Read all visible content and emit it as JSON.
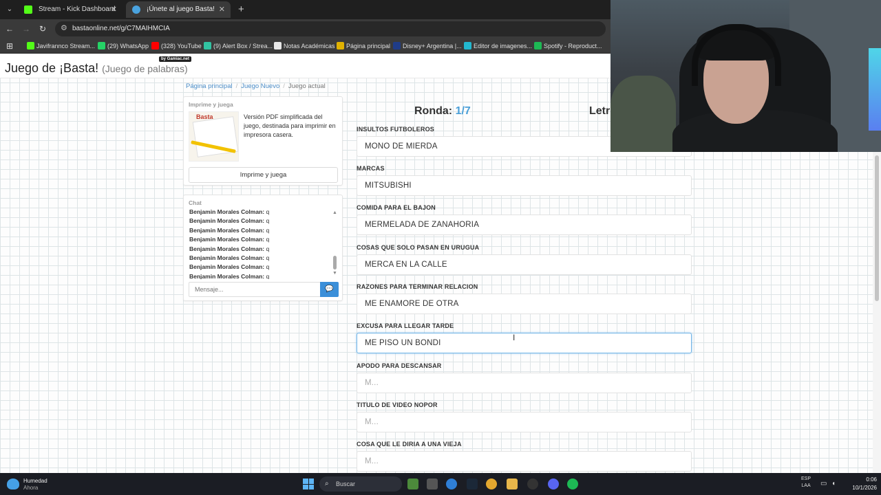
{
  "browser": {
    "tabs": [
      {
        "title": "Stream - Kick Dashboard"
      },
      {
        "title": "¡Únete al juego Basta!"
      }
    ],
    "url": "bastaonline.net/g/C7MAIHMCIA",
    "bookmarks": [
      {
        "label": "Javifrannco Stream...",
        "color": "#53fc18"
      },
      {
        "label": "(29) WhatsApp",
        "color": "#25d366"
      },
      {
        "label": "(328) YouTube",
        "color": "#ff0000"
      },
      {
        "label": "(9) Alert Box / Strea...",
        "color": "#31c3a2"
      },
      {
        "label": "Notas Académicas",
        "color": "#e8e8e8"
      },
      {
        "label": "Página principal",
        "color": "#e0b100"
      },
      {
        "label": "Disney+ Argentina |...",
        "color": "#1f3c88"
      },
      {
        "label": "Editor de imagenes...",
        "color": "#22b8cf"
      },
      {
        "label": "Spotify - Reproduct...",
        "color": "#1db954"
      }
    ]
  },
  "site": {
    "title": "Juego de ¡Basta!",
    "subtitle": "(Juego de palabras)",
    "badge": "by Gamiac.net",
    "breadcrumb": {
      "home": "Página principal",
      "new_game": "Juego Nuevo",
      "current": "Juego actual"
    }
  },
  "print_panel": {
    "title": "Imprime y juega",
    "description": "Versión PDF simplificada del juego, destinada para imprimir en impresora casera.",
    "thumb_logo": "Basta",
    "button": "Imprime y juega"
  },
  "chat": {
    "title": "Chat",
    "messages": [
      {
        "author": "Benjamin Morales Colman:",
        "text": "q"
      },
      {
        "author": "Benjamin Morales Colman:",
        "text": "q"
      },
      {
        "author": "Benjamin Morales Colman:",
        "text": "q"
      },
      {
        "author": "Benjamin Morales Colman:",
        "text": "q"
      },
      {
        "author": "Benjamin Morales Colman:",
        "text": "q"
      },
      {
        "author": "Benjamin Morales Colman:",
        "text": "q"
      },
      {
        "author": "Benjamin Morales Colman:",
        "text": "q"
      },
      {
        "author": "Benjamin Morales Colman:",
        "text": "q"
      }
    ],
    "input_placeholder": "Mensaje..."
  },
  "game": {
    "round_label": "Ronda:",
    "round_value": "1/7",
    "letter_label": "Letr",
    "categories": [
      {
        "label": "INSULTOS FUTBOLEROS",
        "value": "MONO DE MIERDA",
        "placeholder": ""
      },
      {
        "label": "MARCAS",
        "value": "MITSUBISHI",
        "placeholder": ""
      },
      {
        "label": "COMIDA PARA EL BAJON",
        "value": "MERMELADA DE ZANAHORIA",
        "placeholder": ""
      },
      {
        "label": "COSAS QUE SOLO PASAN EN URUGUA",
        "value": "MERCA EN LA CALLE",
        "placeholder": ""
      },
      {
        "label": "RAZONES PARA TERMINAR RELACION",
        "value": "ME ENAMORE DE OTRA",
        "placeholder": ""
      },
      {
        "label": "EXCUSA PARA LLEGAR TARDE",
        "value": "ME PISO UN BONDI",
        "placeholder": ""
      },
      {
        "label": "APODO PARA DESCANSAR",
        "value": "",
        "placeholder": "M..."
      },
      {
        "label": "TITULO DE VIDEO NOPOR",
        "value": "",
        "placeholder": "M..."
      },
      {
        "label": "COSA QUE LE DIRIA A UNA VIEJA",
        "value": "",
        "placeholder": "M..."
      }
    ]
  },
  "taskbar": {
    "weather_label": "Humedad",
    "weather_sub": "Ahora",
    "search_label": "Buscar",
    "lang_top": "ESP",
    "lang_bottom": "LAA",
    "time": "0:06",
    "date": "10/1/2026"
  }
}
